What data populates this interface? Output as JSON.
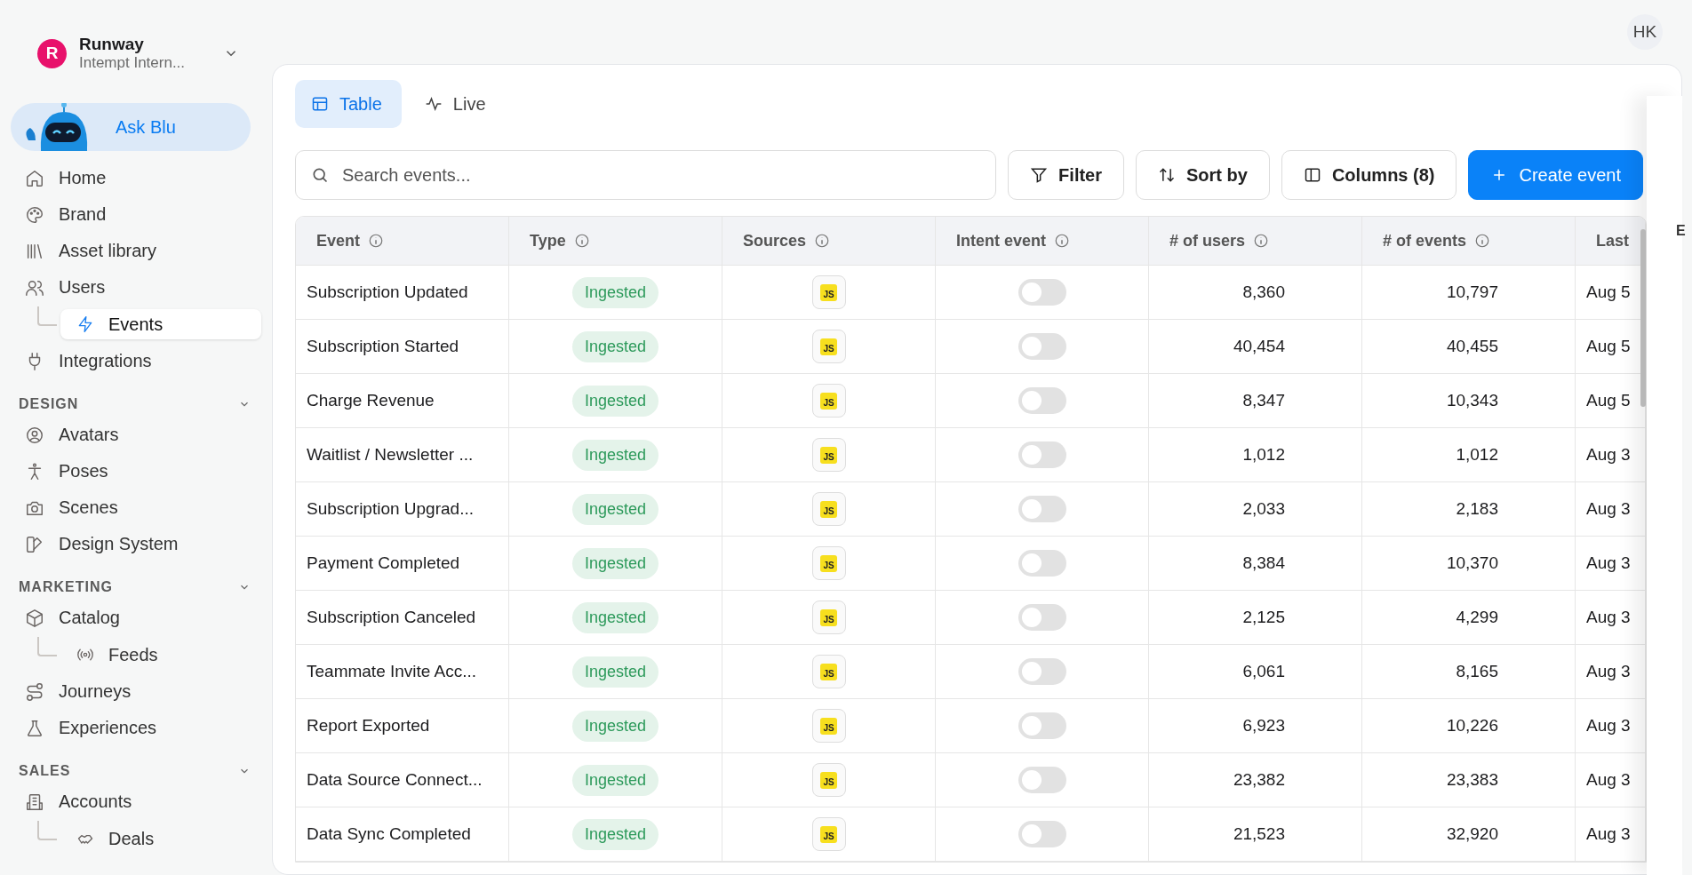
{
  "sidebar": {
    "workspace": {
      "initial": "R",
      "name": "Runway",
      "subtitle": "Intempt Intern..."
    },
    "ask_button": "Ask Blu",
    "groups": [
      {
        "items": [
          {
            "label": "Home",
            "selected": false
          },
          {
            "label": "Brand",
            "selected": false
          },
          {
            "label": "Asset library",
            "selected": false
          },
          {
            "label": "Users",
            "selected": false,
            "children": [
              {
                "label": "Events",
                "selected": true
              }
            ]
          },
          {
            "label": "Integrations",
            "selected": false
          }
        ]
      },
      {
        "title": "DESIGN",
        "items": [
          {
            "label": "Avatars",
            "selected": false
          },
          {
            "label": "Poses",
            "selected": false
          },
          {
            "label": "Scenes",
            "selected": false
          },
          {
            "label": "Design System",
            "selected": false
          }
        ]
      },
      {
        "title": "MARKETING",
        "items": [
          {
            "label": "Catalog",
            "selected": false,
            "children": [
              {
                "label": "Feeds",
                "selected": false
              }
            ]
          },
          {
            "label": "Journeys",
            "selected": false
          },
          {
            "label": "Experiences",
            "selected": false
          }
        ]
      },
      {
        "title": "SALES",
        "items": [
          {
            "label": "Accounts",
            "selected": false,
            "children": [
              {
                "label": "Deals",
                "selected": false
              }
            ]
          }
        ]
      }
    ]
  },
  "user_avatar": "HK",
  "view_tabs": [
    {
      "label": "Table",
      "selected": true
    },
    {
      "label": "Live",
      "selected": false
    }
  ],
  "toolbar": {
    "search": {
      "placeholder": "Search events..."
    },
    "buttons": [
      {
        "label": "Filter",
        "kind": "filter"
      },
      {
        "label": "Sort by",
        "kind": "sort"
      },
      {
        "label": "Columns (8)",
        "kind": "columns"
      },
      {
        "label": "Create event",
        "kind": "create"
      }
    ]
  },
  "table": {
    "columns": [
      "Event",
      "Type",
      "Sources",
      "Intent event",
      "# of users",
      "# of events",
      "Last"
    ],
    "rows": [
      {
        "event": "Subscription Updated",
        "type": "Ingested",
        "source": "JS",
        "intent_on": false,
        "users": "8,360",
        "events": "10,797",
        "last": "Aug 5"
      },
      {
        "event": "Subscription Started",
        "type": "Ingested",
        "source": "JS",
        "intent_on": false,
        "users": "40,454",
        "events": "40,455",
        "last": "Aug 5"
      },
      {
        "event": "Charge Revenue",
        "type": "Ingested",
        "source": "JS",
        "intent_on": false,
        "users": "8,347",
        "events": "10,343",
        "last": "Aug 5"
      },
      {
        "event": "Waitlist / Newsletter ...",
        "type": "Ingested",
        "source": "JS",
        "intent_on": false,
        "users": "1,012",
        "events": "1,012",
        "last": "Aug 3"
      },
      {
        "event": "Subscription Upgrad...",
        "type": "Ingested",
        "source": "JS",
        "intent_on": false,
        "users": "2,033",
        "events": "2,183",
        "last": "Aug 3"
      },
      {
        "event": "Payment Completed",
        "type": "Ingested",
        "source": "JS",
        "intent_on": false,
        "users": "8,384",
        "events": "10,370",
        "last": "Aug 3"
      },
      {
        "event": "Subscription Canceled",
        "type": "Ingested",
        "source": "JS",
        "intent_on": false,
        "users": "2,125",
        "events": "4,299",
        "last": "Aug 3"
      },
      {
        "event": "Teammate Invite Acc...",
        "type": "Ingested",
        "source": "JS",
        "intent_on": false,
        "users": "6,061",
        "events": "8,165",
        "last": "Aug 3"
      },
      {
        "event": "Report Exported",
        "type": "Ingested",
        "source": "JS",
        "intent_on": false,
        "users": "6,923",
        "events": "10,226",
        "last": "Aug 3"
      },
      {
        "event": "Data Source Connect...",
        "type": "Ingested",
        "source": "JS",
        "intent_on": false,
        "users": "23,382",
        "events": "23,383",
        "last": "Aug 3"
      },
      {
        "event": "Data Sync Completed",
        "type": "Ingested",
        "source": "JS",
        "intent_on": false,
        "users": "21,523",
        "events": "32,920",
        "last": "Aug 3"
      }
    ]
  },
  "side_panel": {
    "label": "E"
  }
}
